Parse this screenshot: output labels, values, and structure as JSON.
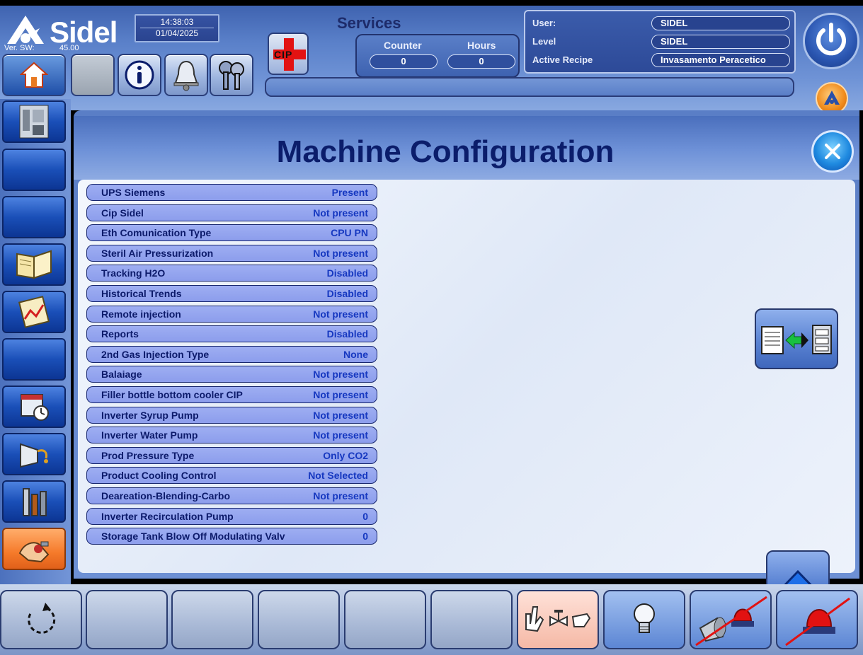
{
  "header": {
    "logo_text": "Sidel",
    "version_label": "Ver. SW:",
    "version_value": "45.00",
    "time": "14:38:03",
    "date": "01/04/2025",
    "services_title": "Services",
    "counter_label": "Counter",
    "hours_label": "Hours",
    "counter_value": "0",
    "hours_value": "0",
    "cip_label": "CIP",
    "user_label": "User:",
    "user_value": "SIDEL",
    "level_label": "Level",
    "level_value": "SIDEL",
    "recipe_label": "Active Recipe",
    "recipe_value": "Invasamento Peracetico",
    "message": ""
  },
  "page": {
    "title": "Machine Configuration"
  },
  "config_rows": [
    {
      "label": "UPS Siemens",
      "value": "Present"
    },
    {
      "label": "Cip Sidel",
      "value": "Not present"
    },
    {
      "label": "Eth Comunication Type",
      "value": "CPU PN"
    },
    {
      "label": "Steril Air Pressurization",
      "value": "Not present"
    },
    {
      "label": "Tracking H2O",
      "value": "Disabled"
    },
    {
      "label": "Historical Trends",
      "value": "Disabled"
    },
    {
      "label": "Remote injection",
      "value": "Not present"
    },
    {
      "label": "Reports",
      "value": "Disabled"
    },
    {
      "label": "2nd Gas Injection Type",
      "value": "None"
    },
    {
      "label": "Balaiage",
      "value": "Not present"
    },
    {
      "label": "Filler bottle bottom cooler CIP",
      "value": "Not present"
    },
    {
      "label": "Inverter Syrup Pump",
      "value": "Not present"
    },
    {
      "label": "Inverter Water Pump",
      "value": "Not present"
    },
    {
      "label": "Prod Pressure Type",
      "value": "Only CO2"
    },
    {
      "label": "Product Cooling Control",
      "value": "Not Selected"
    },
    {
      "label": "Deareation-Blending-Carbo",
      "value": "Not present"
    },
    {
      "label": "Inverter Recirculation Pump",
      "value": "0"
    },
    {
      "label": "Storage Tank Blow Off Modulating Valv",
      "value": "0"
    }
  ],
  "colors": {
    "accent": "#0b1d6b",
    "row_bg": "#9eaef2",
    "value_text": "#1638c0",
    "alarm_red": "#e21212"
  }
}
